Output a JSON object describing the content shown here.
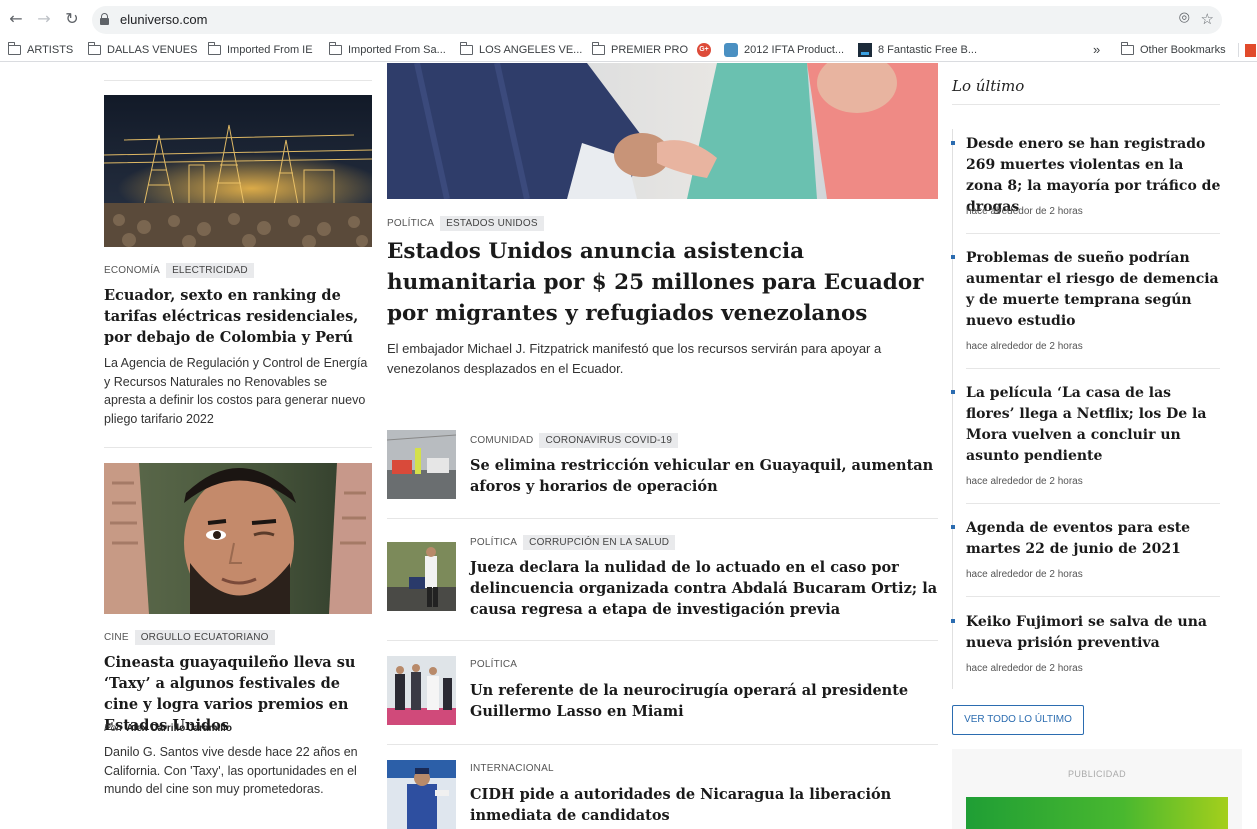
{
  "browser": {
    "url": "eluniverso.com",
    "bookmarks": [
      "ARTISTS",
      "DALLAS VENUES",
      "Imported From IE",
      "Imported From Sa...",
      "LOS ANGELES VE...",
      "PREMIER PRO",
      "2012 IFTA Product...",
      "8 Fantastic Free B...",
      "Other Bookmarks"
    ],
    "overflow_label": "»"
  },
  "left": {
    "story1": {
      "category": "ECONOMÍA",
      "tag": "ELECTRICIDAD",
      "title": "Ecuador, sexto en ranking de tarifas eléctricas residenciales, por debajo de Colombia y Perú",
      "summary": "La Agencia de Regulación y Control de Energía y Recursos Naturales no Renovables se apresta a definir los costos para generar nuevo pliego tarifario 2022"
    },
    "story2": {
      "category": "CINE",
      "tag": "ORGULLO ECUATORIANO",
      "title": "Cineasta guayaquileño lleva su ‘Taxy’ a algunos festivales de cine y logra varios premios en Estados Unidos",
      "byline_prefix": "Por:",
      "author": "Alex Carrillo Jaramillo",
      "summary": "Danilo G. Santos vive desde hace 22 años en California. Con 'Taxy', las oportunidades en el mundo del cine son muy prometedoras."
    }
  },
  "center": {
    "main": {
      "category": "POLÍTICA",
      "tag": "ESTADOS UNIDOS",
      "title": "Estados Unidos anuncia asistencia humanitaria por $ 25 millones para Ecuador por migrantes y refugiados venezolanos",
      "summary": "El embajador Michael J. Fitzpatrick manifestó que los recursos servirán para apoyar a venezolanos desplazados en el Ecuador."
    },
    "items": [
      {
        "category": "COMUNIDAD",
        "tag": "CORONAVIRUS COVID-19",
        "title": "Se elimina restricción vehicular en Guayaquil, aumentan aforos y horarios de operación"
      },
      {
        "category": "POLÍTICA",
        "tag": "CORRUPCIÓN EN LA SALUD",
        "title": "Jueza declara la nulidad de lo actuado en el caso por delincuencia organizada contra Abdalá Bucaram Ortiz; la causa regresa a etapa de investigación previa"
      },
      {
        "category": "POLÍTICA",
        "tag": "",
        "title": "Un referente de la neurocirugía operará al presidente Guillermo Lasso en Miami"
      },
      {
        "category": "INTERNACIONAL",
        "tag": "",
        "title": "CIDH pide a autoridades de Nicaragua la liberación inmediata de candidatos"
      }
    ]
  },
  "sidebar": {
    "title": "Lo último",
    "items": [
      {
        "title": "Desde enero se han registrado 269 muertes violentas en la zona 8; la mayoría por tráfico de drogas",
        "time": "hace alrededor de 2 horas"
      },
      {
        "title": "Problemas de sueño podrían aumentar el riesgo de demencia y de muerte temprana según nuevo estudio",
        "time": "hace alrededor de 2 horas"
      },
      {
        "title": "La película ‘La casa de las flores’ llega a Netflix; los De la Mora vuelven a concluir un asunto pendiente",
        "time": "hace alrededor de 2 horas"
      },
      {
        "title": "Agenda de eventos para este martes 22 de junio de 2021",
        "time": "hace alrededor de 2 horas"
      },
      {
        "title": "Keiko Fujimori se salva de una nueva prisión preventiva",
        "time": "hace alrededor de 2 horas"
      }
    ],
    "view_all": "VER TODO LO ÚLTIMO",
    "ad_label": "PUBLICIDAD"
  }
}
